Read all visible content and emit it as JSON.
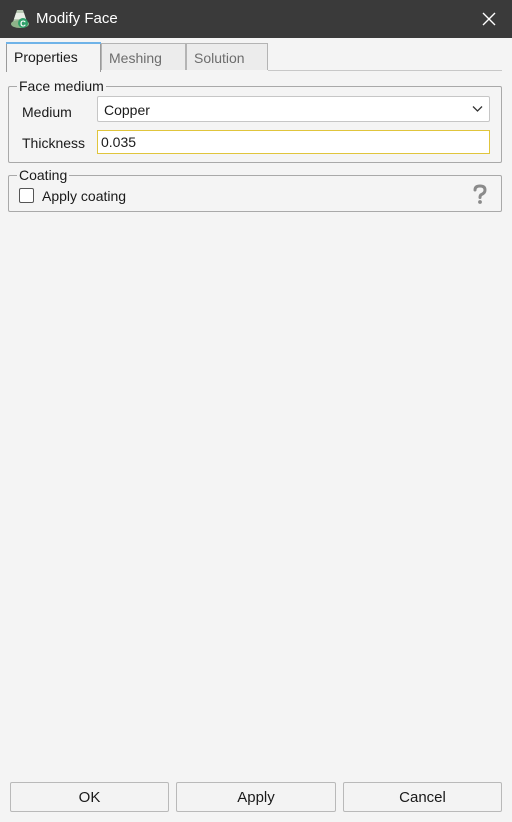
{
  "window": {
    "title": "Modify Face",
    "icon": "app-logo-icon",
    "close_icon": "close-icon"
  },
  "tabs": [
    {
      "label": "Properties",
      "active": true
    },
    {
      "label": "Meshing",
      "active": false
    },
    {
      "label": "Solution",
      "active": false
    }
  ],
  "face_medium": {
    "legend": "Face medium",
    "medium_label": "Medium",
    "medium_value": "Copper",
    "thickness_label": "Thickness",
    "thickness_value": "0.035"
  },
  "coating": {
    "legend": "Coating",
    "apply_label": "Apply coating",
    "apply_checked": false,
    "help_icon": "question-mark-icon"
  },
  "buttons": {
    "ok": "OK",
    "apply": "Apply",
    "cancel": "Cancel"
  },
  "colors": {
    "titlebar": "#3a3a3a",
    "tab_highlight": "#6fb3e8",
    "focus_border": "#e0c53c"
  }
}
